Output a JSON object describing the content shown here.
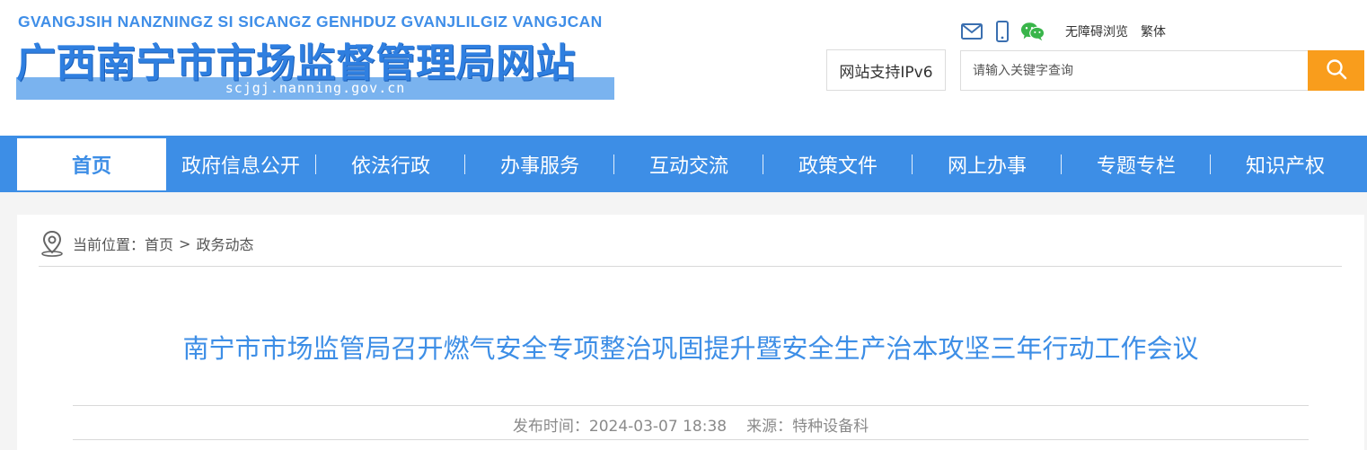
{
  "site": {
    "pinyin": "GVANGJSIH NANZNINGZ SI SICANGZ GENHDUZ GVANJLILGIZ VANGJCAN",
    "title": "广西南宁市市场监督管理局网站",
    "domain": "scjgj.nanning.gov.cn"
  },
  "top_links": {
    "icons": [
      "mail-icon",
      "mobile-icon",
      "wechat-icon"
    ],
    "accessibility": "无障碍浏览",
    "traditional": "繁体"
  },
  "ipv6_badge": "网站支持IPv6",
  "search": {
    "placeholder": "请输入关键字查询",
    "icon": "search-icon"
  },
  "nav": {
    "items": [
      {
        "label": "首页",
        "active": true
      },
      {
        "label": "政府信息公开"
      },
      {
        "label": "依法行政"
      },
      {
        "label": "办事服务"
      },
      {
        "label": "互动交流"
      },
      {
        "label": "政策文件"
      },
      {
        "label": "网上办事"
      },
      {
        "label": "专题专栏"
      },
      {
        "label": "知识产权"
      }
    ]
  },
  "breadcrumb": {
    "prefix": "当前位置：",
    "items": [
      "首页",
      "政务动态"
    ],
    "separator": ">"
  },
  "article": {
    "title": "南宁市市场监管局召开燃气安全专项整治巩固提升暨安全生产治本攻坚三年行动工作会议",
    "publish_label": "发布时间：",
    "publish_time": "2024-03-07 18:38",
    "source_label": "来源：",
    "source": "特种设备科"
  },
  "colors": {
    "primary_blue": "#3d8ee6",
    "logo_blue": "#2f7fe0",
    "search_orange": "#f99d1c",
    "wechat_green": "#39b54a"
  }
}
